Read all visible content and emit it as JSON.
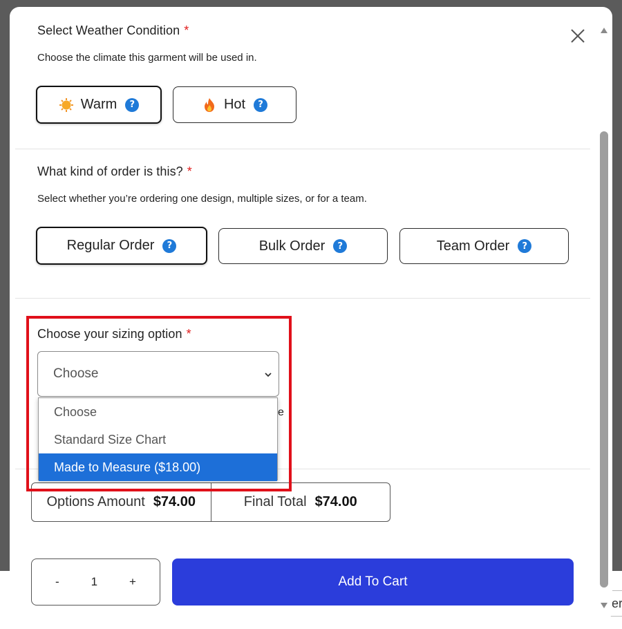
{
  "background_page": {
    "peek_text": "er"
  },
  "weather": {
    "title": "Select Weather Condition",
    "required_mark": "*",
    "description": "Choose the climate this garment will be used in.",
    "options": [
      {
        "label": "Warm",
        "icon": "sun-icon",
        "selected": true
      },
      {
        "label": "Hot",
        "icon": "fire-icon",
        "selected": false
      }
    ]
  },
  "order_type": {
    "title": "What kind of order is this?",
    "required_mark": "*",
    "description": "Select whether you’re ordering one design, multiple sizes, or for a team.",
    "options": [
      {
        "label": "Regular Order",
        "selected": true
      },
      {
        "label": "Bulk Order",
        "selected": false
      },
      {
        "label": "Team Order",
        "selected": false
      }
    ]
  },
  "sizing": {
    "title": "Choose your sizing option",
    "required_mark": "*",
    "selected_value": "Choose",
    "options": [
      "Choose",
      "Standard Size Chart",
      "Made to Measure ($18.00)"
    ],
    "highlighted_option": "Made to Measure ($18.00)",
    "obscured_text": "e"
  },
  "help_glyph": "?",
  "totals": {
    "options_label": "Options Amount",
    "options_value": "$74.00",
    "final_label": "Final Total",
    "final_value": "$74.00"
  },
  "quantity": {
    "minus": "-",
    "value": "1",
    "plus": "+"
  },
  "add_to_cart_label": "Add To Cart",
  "colors": {
    "required": "#e11d1d",
    "help_badge": "#1f7ad8",
    "cart_button": "#2b3ddb",
    "dropdown_highlight": "#1d6fd8",
    "annotation_box": "#e0101a"
  }
}
